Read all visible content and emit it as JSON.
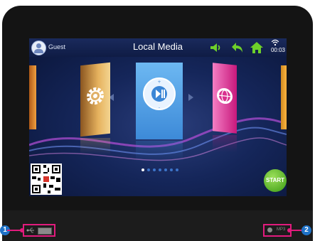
{
  "screen": {
    "topbar": {
      "user_name": "Guest",
      "title": "Local Media",
      "time": "00:03",
      "icons": [
        "avatar-icon",
        "volume-icon",
        "back-icon",
        "home-icon",
        "wifi-icon"
      ]
    },
    "cards": [
      "settings-card",
      "media-player-card",
      "web-card"
    ],
    "page_indicator": {
      "total": 7,
      "active": 1
    },
    "start_label": "START",
    "colors": {
      "accent": "#6ed02a",
      "screen_bg": "#15265a",
      "callout": "#e21b7d",
      "callout_num": "#1f72c8"
    }
  },
  "callouts": {
    "left": {
      "number": "1",
      "port_label": ""
    },
    "right": {
      "number": "2",
      "port_label": "MP3"
    }
  }
}
